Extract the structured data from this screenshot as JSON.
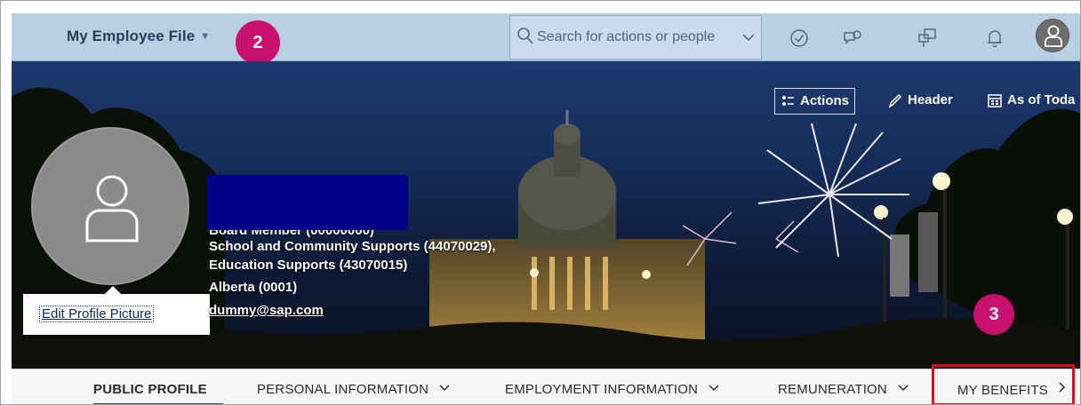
{
  "shell": {
    "app_title": "My Employee File",
    "search_placeholder": "Search for actions or people"
  },
  "callouts": {
    "badge_top": "2",
    "badge_bottom": "3",
    "badge_color": "#c8106f",
    "highlight_color": "#e3071e"
  },
  "banner": {
    "actions_label": "Actions",
    "header_label": "Header",
    "as_of_label": "As of Toda"
  },
  "profile": {
    "edit_picture_link": "Edit Profile Picture",
    "position_partial": "Board Member (00000000)",
    "department": "School and Community Supports (44070029),",
    "division": "Education Supports (43070015)",
    "location": "Alberta (0001)",
    "email": "dummy@sap.com"
  },
  "tabs": [
    {
      "label": "PUBLIC PROFILE",
      "selected": true
    },
    {
      "label": "PERSONAL INFORMATION",
      "selected": false
    },
    {
      "label": "EMPLOYMENT INFORMATION",
      "selected": false
    },
    {
      "label": "REMUNERATION",
      "selected": false
    },
    {
      "label": "MY BENEFITS",
      "selected": false
    }
  ],
  "colors": {
    "shellbar": "#b9cfe4",
    "tab_underline": "#31425a"
  },
  "icons": {
    "search": "search-icon",
    "todo": "todo-check-icon",
    "feedback": "feedback-icon",
    "approvals": "approvals-icon",
    "notifications": "bell-icon",
    "user": "user-avatar-icon"
  }
}
